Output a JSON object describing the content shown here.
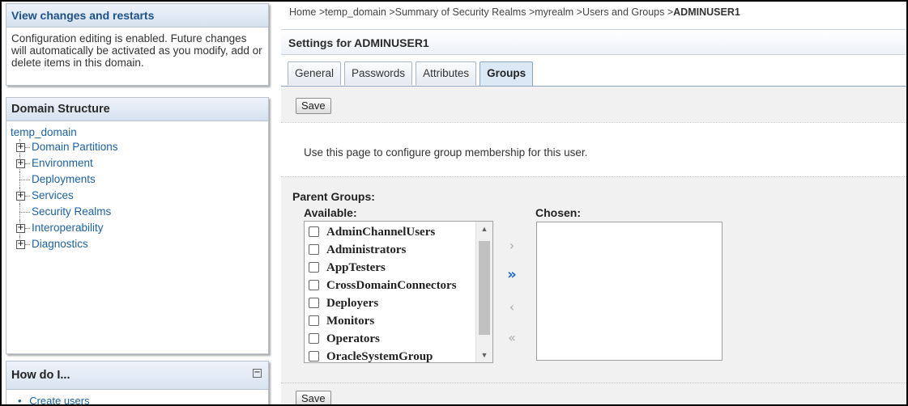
{
  "change_center": {
    "title": "View changes and restarts",
    "message": "Configuration editing is enabled. Future changes will automatically be activated as you modify, add or delete items in this domain."
  },
  "domain_structure": {
    "title": "Domain Structure",
    "root": "temp_domain",
    "items": [
      {
        "label": "Domain Partitions",
        "expandable": true
      },
      {
        "label": "Environment",
        "expandable": true
      },
      {
        "label": "Deployments",
        "expandable": false
      },
      {
        "label": "Services",
        "expandable": true
      },
      {
        "label": "Security Realms",
        "expandable": false
      },
      {
        "label": "Interoperability",
        "expandable": true
      },
      {
        "label": "Diagnostics",
        "expandable": true
      }
    ]
  },
  "how_do_i": {
    "title": "How do I...",
    "first_item": "Create users"
  },
  "breadcrumb": {
    "path": "Home >temp_domain >Summary of Security Realms >myrealm >Users and Groups >",
    "current": "ADMINUSER1"
  },
  "settings_title": "Settings for ADMINUSER1",
  "tabs": [
    {
      "label": "General",
      "active": false
    },
    {
      "label": "Passwords",
      "active": false
    },
    {
      "label": "Attributes",
      "active": false
    },
    {
      "label": "Groups",
      "active": true
    }
  ],
  "buttons": {
    "save": "Save"
  },
  "description": "Use this page to configure group membership for this user.",
  "parent_groups": {
    "title": "Parent Groups:",
    "available_label": "Available:",
    "chosen_label": "Chosen:",
    "available": [
      "AdminChannelUsers",
      "Administrators",
      "AppTesters",
      "CrossDomainConnectors",
      "Deployers",
      "Monitors",
      "Operators",
      "OracleSystemGroup"
    ],
    "chosen": []
  },
  "icons": {
    "move_right": "›",
    "move_all_right": "»",
    "move_left": "‹",
    "move_all_left": "«"
  },
  "colors": {
    "accent": "#1c6fd0",
    "link": "#1a62a8"
  }
}
